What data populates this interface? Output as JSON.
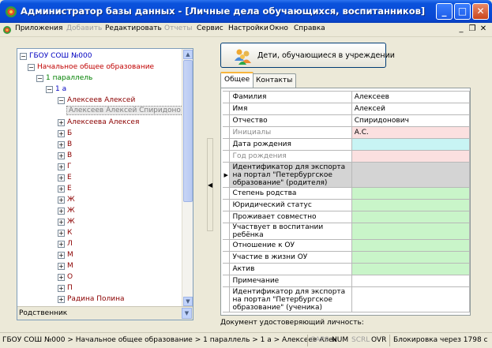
{
  "window": {
    "title": "Администратор базы данных - [Личные дела обучающихся, воспитанников]",
    "minimize": "_",
    "maximize": "□",
    "close": "✕"
  },
  "menu": {
    "items": [
      {
        "label": "Приложения",
        "enabled": true
      },
      {
        "label": "Добавить",
        "enabled": false
      },
      {
        "label": "Редактировать",
        "enabled": true
      },
      {
        "label": "Отчеты",
        "enabled": false
      },
      {
        "label": "Сервис",
        "enabled": true
      },
      {
        "label": "Настройки",
        "enabled": true
      },
      {
        "label": "Окно",
        "enabled": true
      },
      {
        "label": "Справка",
        "enabled": true
      }
    ],
    "mdi_min": "_",
    "mdi_restore": "❐",
    "mdi_close": "✕"
  },
  "tree": {
    "root": "ГБОУ СОШ №000",
    "level1": "Начальное общее образование",
    "level2": "1 параллель",
    "level3": "1 а",
    "student1": "Алексеев Алексей",
    "student1_child": "Алексеев Алексей Спиридоно",
    "student2": "Алексеева Алексея",
    "collapsed": [
      "Б",
      "В",
      "В",
      "Г",
      "Е",
      "Е",
      "Ж",
      "Ж",
      "Ж",
      "К",
      "Л",
      "М",
      "М",
      "О",
      "П"
    ],
    "last": "Радина Полина",
    "footer": "Родственник"
  },
  "main": {
    "big_button": "Дети, обучающиеся в учреждении",
    "tabs": [
      "Общее",
      "Контакты"
    ],
    "rows": [
      {
        "label": "Фамилия",
        "value": "Алексеев",
        "color": "white"
      },
      {
        "label": "Имя",
        "value": "Алексей",
        "color": "white"
      },
      {
        "label": "Отчество",
        "value": "Спиридонович",
        "color": "white"
      },
      {
        "label": "Инициалы",
        "value": "А.С.",
        "color": "pink",
        "muted": true
      },
      {
        "label": "Дата рождения",
        "value": "",
        "color": "cyan"
      },
      {
        "label": "Год рождения",
        "value": "",
        "color": "pink",
        "muted": true
      },
      {
        "label": "Идентификатор для экспорта на портал \"Петербургское образование\" (родителя)",
        "value": "",
        "color": "grey",
        "current": true
      },
      {
        "label": "Степень родства",
        "value": "",
        "color": "green"
      },
      {
        "label": "Юридический статус",
        "value": "",
        "color": "green"
      },
      {
        "label": "Проживает совместно",
        "value": "",
        "color": "green"
      },
      {
        "label": "Участвует в воспитании ребёнка",
        "value": "",
        "color": "green"
      },
      {
        "label": "Отношение к ОУ",
        "value": "",
        "color": "green"
      },
      {
        "label": "Участие в жизни ОУ",
        "value": "",
        "color": "green"
      },
      {
        "label": "Актив",
        "value": "",
        "color": "green"
      },
      {
        "label": "Примечание",
        "value": "",
        "color": "white"
      },
      {
        "label": "Идентификатор для экспорта на портал \"Петербургское образование\" (ученика)",
        "value": "",
        "color": "white"
      }
    ],
    "doc_label": "Документ удостоверяющий личность:"
  },
  "status": {
    "path": "ГБОУ СОШ №000 > Начальное общее образование > 1 параллель > 1 а > Алексеев Алек",
    "caps": "CAPS",
    "num": "NUM",
    "scrl": "SCRL",
    "ovr": "OVR",
    "lock": "Блокировка через 1798 с"
  },
  "colors": {
    "pink": "#fbe0e0",
    "cyan": "#c8f4f4",
    "green": "#c9f5c9",
    "grey": "#d4d4d4",
    "title_blue": "#0846d2"
  }
}
